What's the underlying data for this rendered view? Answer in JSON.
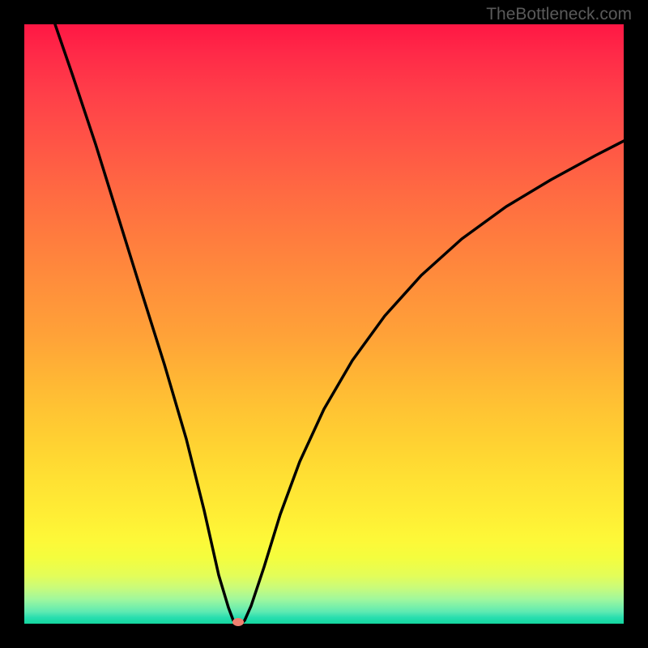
{
  "watermark": "TheBottleneck.com",
  "chart_data": {
    "type": "line",
    "title": "",
    "xlabel": "",
    "ylabel": "",
    "xlim": [
      0,
      100
    ],
    "ylim": [
      0,
      100
    ],
    "background_gradient": {
      "direction": "vertical",
      "stops": [
        {
          "pos": 0,
          "color": "#ff1744"
        },
        {
          "pos": 50,
          "color": "#ffa238"
        },
        {
          "pos": 82,
          "color": "#ffee35"
        },
        {
          "pos": 100,
          "color": "#14d69e"
        }
      ]
    },
    "series": [
      {
        "name": "bottleneck-curve",
        "x": [
          0,
          5,
          10,
          15,
          20,
          25,
          30,
          33,
          35,
          36,
          40,
          45,
          50,
          55,
          60,
          65,
          70,
          75,
          80,
          85,
          90,
          95,
          100
        ],
        "y": [
          100,
          86,
          72,
          58,
          43,
          28,
          13,
          3,
          0,
          0,
          9,
          20,
          30,
          39,
          47,
          54,
          60,
          65,
          70,
          74,
          77,
          80,
          82
        ]
      }
    ],
    "marker": {
      "x": 35.5,
      "y": 0,
      "color": "#f08070"
    }
  }
}
